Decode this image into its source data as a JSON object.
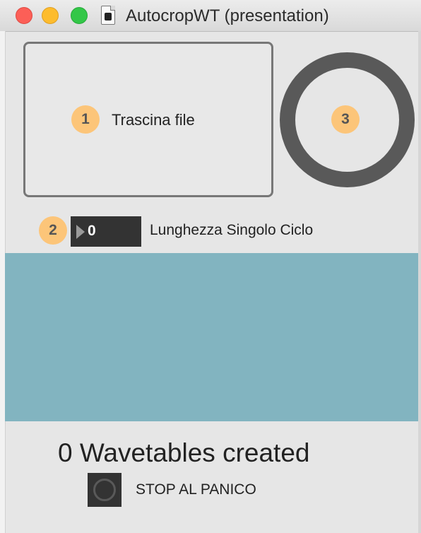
{
  "window": {
    "title": "AutocropWT (presentation)"
  },
  "drop_zone": {
    "step": "1",
    "label": "Trascina file"
  },
  "progress_ring": {
    "step": "3"
  },
  "cycle_length": {
    "step": "2",
    "value": "0",
    "label": "Lunghezza Singolo Ciclo"
  },
  "waveform_display": {
    "background_color": "#82b4c0"
  },
  "status": {
    "wavetables_created": "0 Wavetables created"
  },
  "panic": {
    "label": "STOP AL PANICO"
  },
  "colors": {
    "badge": "#fcc579",
    "ring": "#595959",
    "numbox": "#333333"
  }
}
